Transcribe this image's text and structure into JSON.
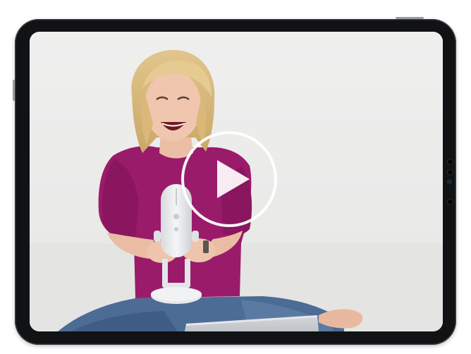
{
  "video": {
    "state": "paused",
    "play_icon": "play-circle-icon",
    "subject": "woman-with-microphone"
  },
  "colors": {
    "tablet_bezel": "#111214",
    "backdrop": "#ececeb",
    "shirt": "#9a1a6a",
    "jeans": "#4a6a94",
    "microphone": "#e9ebee",
    "play_button": "#ffffff"
  }
}
